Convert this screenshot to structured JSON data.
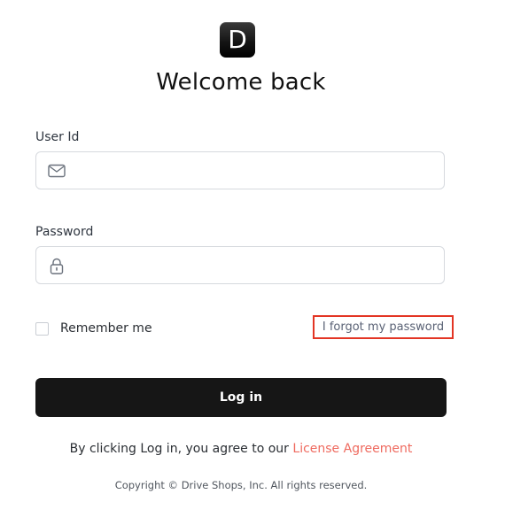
{
  "logo": {
    "letter": "D"
  },
  "heading": "Welcome back",
  "user_id": {
    "label": "User Id",
    "value": "",
    "placeholder": "",
    "icon": "envelope-icon"
  },
  "password": {
    "label": "Password",
    "value": "",
    "placeholder": "",
    "icon": "lock-icon"
  },
  "remember_me": {
    "label": "Remember me",
    "checked": false
  },
  "forgot_link": "I forgot my password",
  "login_button": "Log in",
  "agreement": {
    "prefix": "By clicking Log in, you agree to our ",
    "link": "License Agreement"
  },
  "copyright": "Copyright © Drive Shops, Inc. All rights reserved.",
  "colors": {
    "button": "#161616",
    "link_accent": "#ef6a5f",
    "highlight_box": "#e33524"
  }
}
